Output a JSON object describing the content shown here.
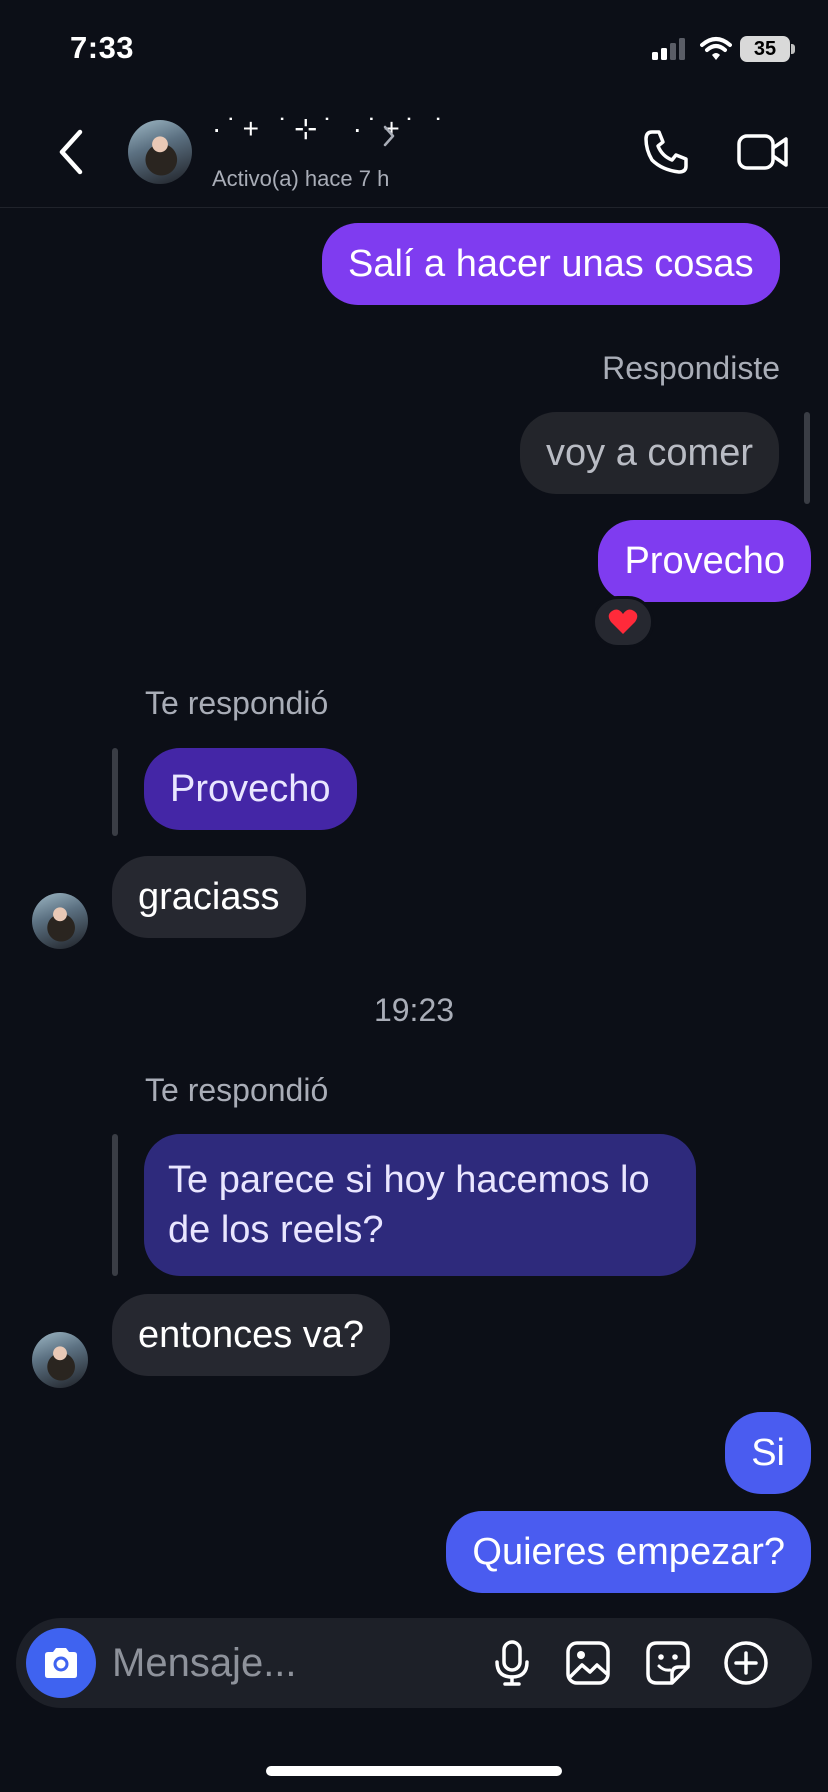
{
  "status_bar": {
    "time": "7:33",
    "battery": "35"
  },
  "header": {
    "contact_name": "·˙+ ˙⊹˙ ·˙+˙ ˙",
    "status": "Activo(a) hace 7 h"
  },
  "messages": {
    "m1": "Salí a hacer unas cosas",
    "reply_label_own": "Respondiste",
    "quoted_own": "voy a comer",
    "m2": "Provecho",
    "m2_reaction": "❤️",
    "reply_label_1": "Te respondió",
    "quoted_1": "Provecho",
    "m3": "graciass",
    "timestamp": "19:23",
    "reply_label_2": "Te respondió",
    "quoted_2": "Te parece si hoy hacemos lo de los reels?",
    "m4": "entonces va?",
    "m5": "Si",
    "m6": "Quieres empezar?"
  },
  "composer": {
    "placeholder": "Mensaje..."
  },
  "colors": {
    "background": "#0c0f17",
    "outgoing_purple": "#7f3cf0",
    "outgoing_blue": "#4a5cf0",
    "incoming": "#262830",
    "camera_button": "#3f63f0"
  },
  "icons": [
    "back-icon",
    "chevron-right-icon",
    "phone-icon",
    "video-camera-icon",
    "camera-icon",
    "microphone-icon",
    "image-icon",
    "sticker-icon",
    "plus-circle-icon",
    "heart-reaction-icon"
  ]
}
